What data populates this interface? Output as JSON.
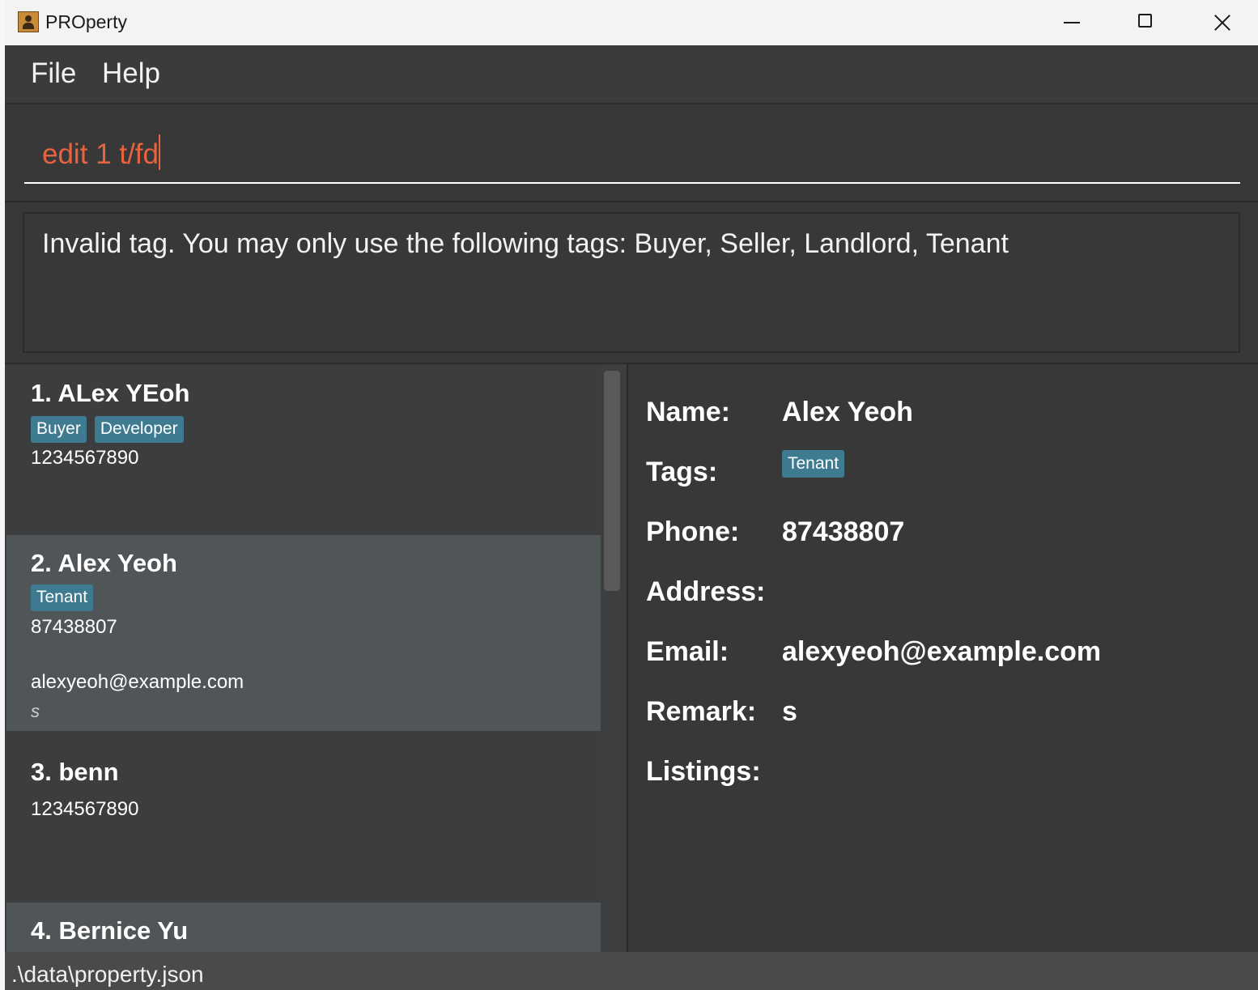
{
  "window": {
    "title": "PROperty"
  },
  "menu": {
    "items": [
      "File",
      "Help"
    ]
  },
  "command": {
    "value": "edit 1 t/fd"
  },
  "result": {
    "message": "Invalid tag. You may only use the following tags: Buyer, Seller, Landlord, Tenant"
  },
  "persons": [
    {
      "name": "1. ALex YEoh",
      "tags": [
        "Buyer",
        "Developer"
      ],
      "phone": "1234567890"
    },
    {
      "name": "2. Alex Yeoh",
      "tags": [
        "Tenant"
      ],
      "phone": "87438807",
      "email": "alexyeoh@example.com",
      "remark": "s"
    },
    {
      "name": "3. benn",
      "phone": "1234567890"
    },
    {
      "name": "4. Bernice Yu"
    }
  ],
  "detail": {
    "labels": {
      "name": "Name:",
      "tags": "Tags:",
      "phone": "Phone:",
      "address": "Address:",
      "email": "Email:",
      "remark": "Remark:",
      "listings": "Listings:"
    },
    "name": "Alex Yeoh",
    "tags": [
      "Tenant"
    ],
    "phone": "87438807",
    "email": "alexyeoh@example.com",
    "remark": "s"
  },
  "status": {
    "path": ".\\data\\property.json"
  },
  "colors": {
    "tag": "#3e7b91",
    "command_text": "#e8633f",
    "selected_card": "#505558"
  }
}
